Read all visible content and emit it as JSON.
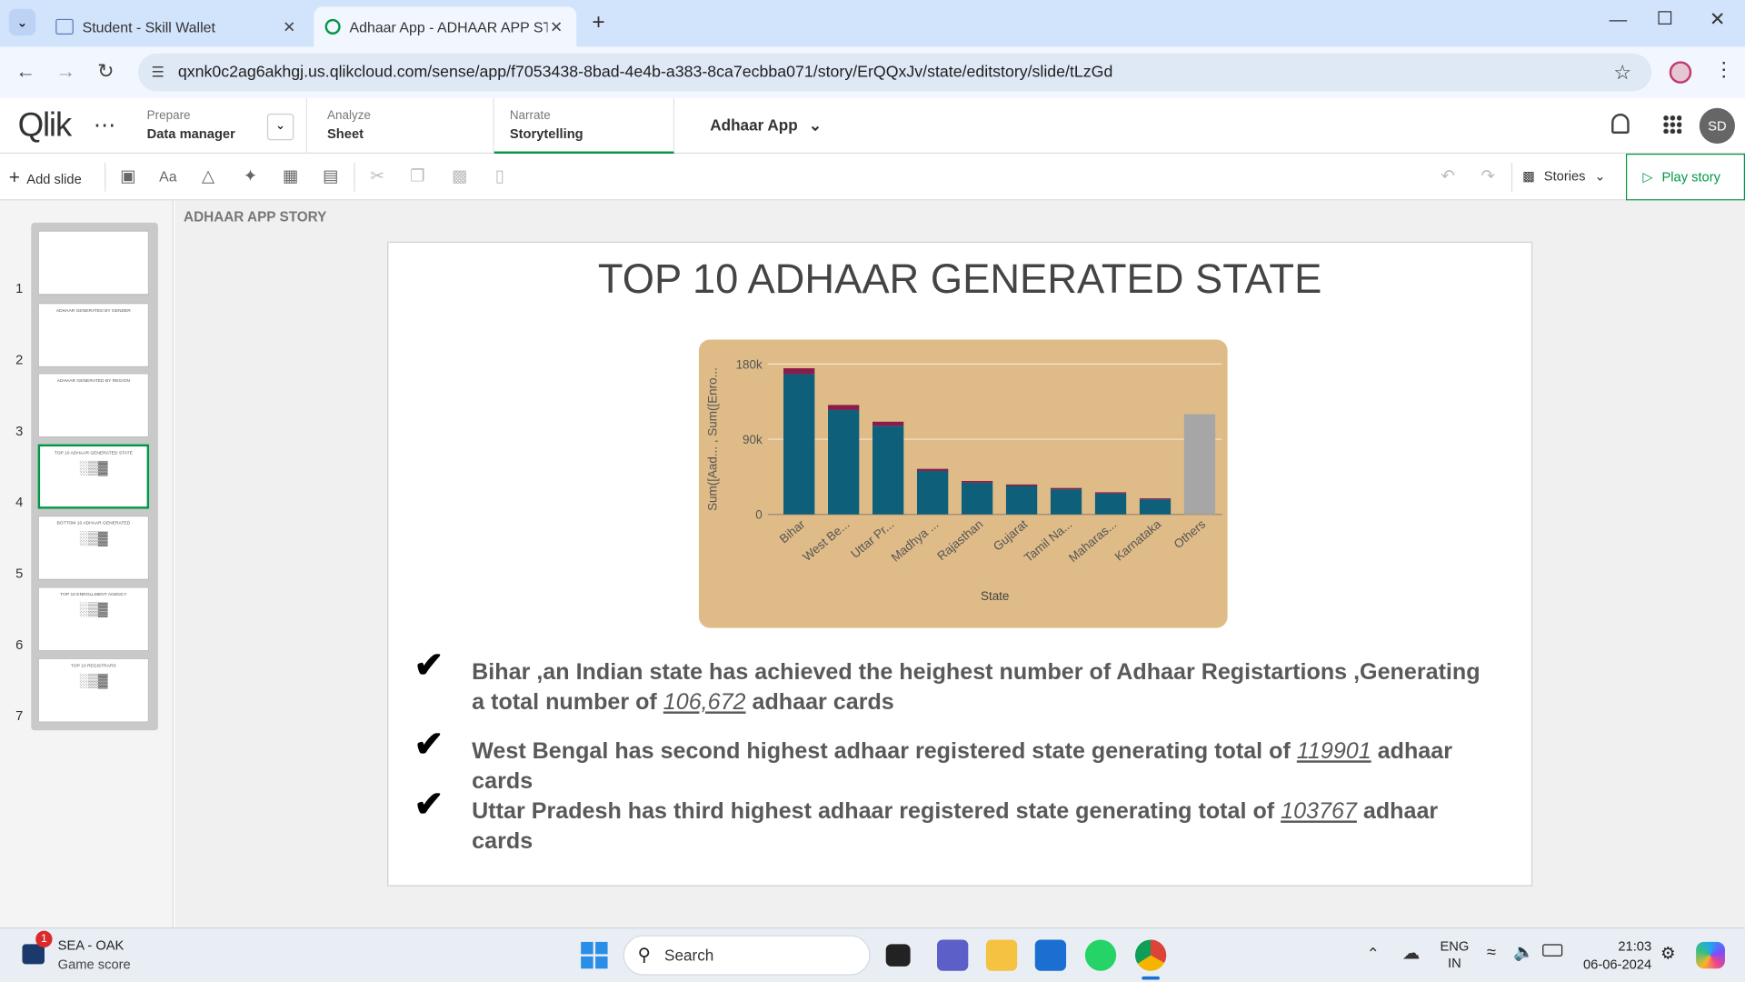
{
  "browser": {
    "tabs": [
      {
        "title": "Student - Skill Wallet"
      },
      {
        "title": "Adhaar App - ADHAAR APP STO"
      }
    ],
    "url": "qxnk0c2ag6akhgj.us.qlikcloud.com/sense/app/f7053438-8bad-4e4b-a383-8ca7ecbba071/story/ErQQxJv/state/editstory/slide/tLzGd"
  },
  "qlik": {
    "logo": "Qlik",
    "prepare": {
      "small": "Prepare",
      "big": "Data manager"
    },
    "analyze": {
      "small": "Analyze",
      "big": "Sheet"
    },
    "narrate": {
      "small": "Narrate",
      "big": "Storytelling"
    },
    "app_name": "Adhaar App",
    "avatar": "SD"
  },
  "toolbar": {
    "add_slide": "Add slide",
    "text_tool": "Aa",
    "stories": "Stories",
    "play_story": "Play story"
  },
  "story_title": "ADHAAR APP STORY",
  "thumbnails": [
    {
      "num": "1",
      "title": ""
    },
    {
      "num": "2",
      "title": "ADHAAR GENERATED BY GENDER"
    },
    {
      "num": "3",
      "title": "ADHAAR GENERATED BY REGION"
    },
    {
      "num": "4",
      "title": "TOP 10 ADHAAR GENERATED STATE"
    },
    {
      "num": "5",
      "title": "BOTTOM 10 ADHAAR GENERATED"
    },
    {
      "num": "6",
      "title": "TOP 10 ENROLLMENT AGENCY"
    },
    {
      "num": "7",
      "title": "TOP 10 REGISTRARS"
    }
  ],
  "slide": {
    "title": "TOP 10 ADHAAR GENERATED STATE",
    "bullets": [
      {
        "pre": "Bihar ,an Indian state has achieved the heighest number of Adhaar Registartions ,Generating a total number of ",
        "num": "106,672",
        "post": " adhaar cards"
      },
      {
        "pre": "West Bengal has second highest adhaar registered state generating total of ",
        "num": "119901",
        "post": " adhaar cards"
      },
      {
        "pre": "Uttar Pradesh has third highest adhaar registered state generating total of ",
        "num": "103767",
        "post": " adhaar cards"
      }
    ]
  },
  "chart_data": {
    "type": "bar",
    "categories": [
      "Bihar",
      "West Be...",
      "Uttar Pr...",
      "Madhya ...",
      "Rajasthan",
      "Gujarat",
      "Tamil Na...",
      "Maharas...",
      "Karnataka",
      "Others"
    ],
    "series": [
      {
        "values": [
          168000,
          125000,
          106000,
          52000,
          38000,
          34000,
          30000,
          25000,
          18000,
          120000
        ],
        "color": "#0e5f7a"
      },
      {
        "values": [
          7000,
          6000,
          5000,
          2500,
          2000,
          1800,
          1600,
          1500,
          1200,
          0
        ],
        "color": "#8a1c4a"
      }
    ],
    "others_color": "#a6a6a6",
    "xlabel": "State",
    "ylabel": "Sum([Aad... , Sum([Enro...",
    "yticks": [
      "0",
      "90k",
      "180k"
    ],
    "ylim": [
      0,
      180000
    ],
    "grid": true
  },
  "taskbar": {
    "widget_title": "SEA - OAK",
    "widget_sub": "Game score",
    "badge": "1",
    "search": "Search",
    "lang1": "ENG",
    "lang2": "IN",
    "time": "21:03",
    "date": "06-06-2024"
  }
}
